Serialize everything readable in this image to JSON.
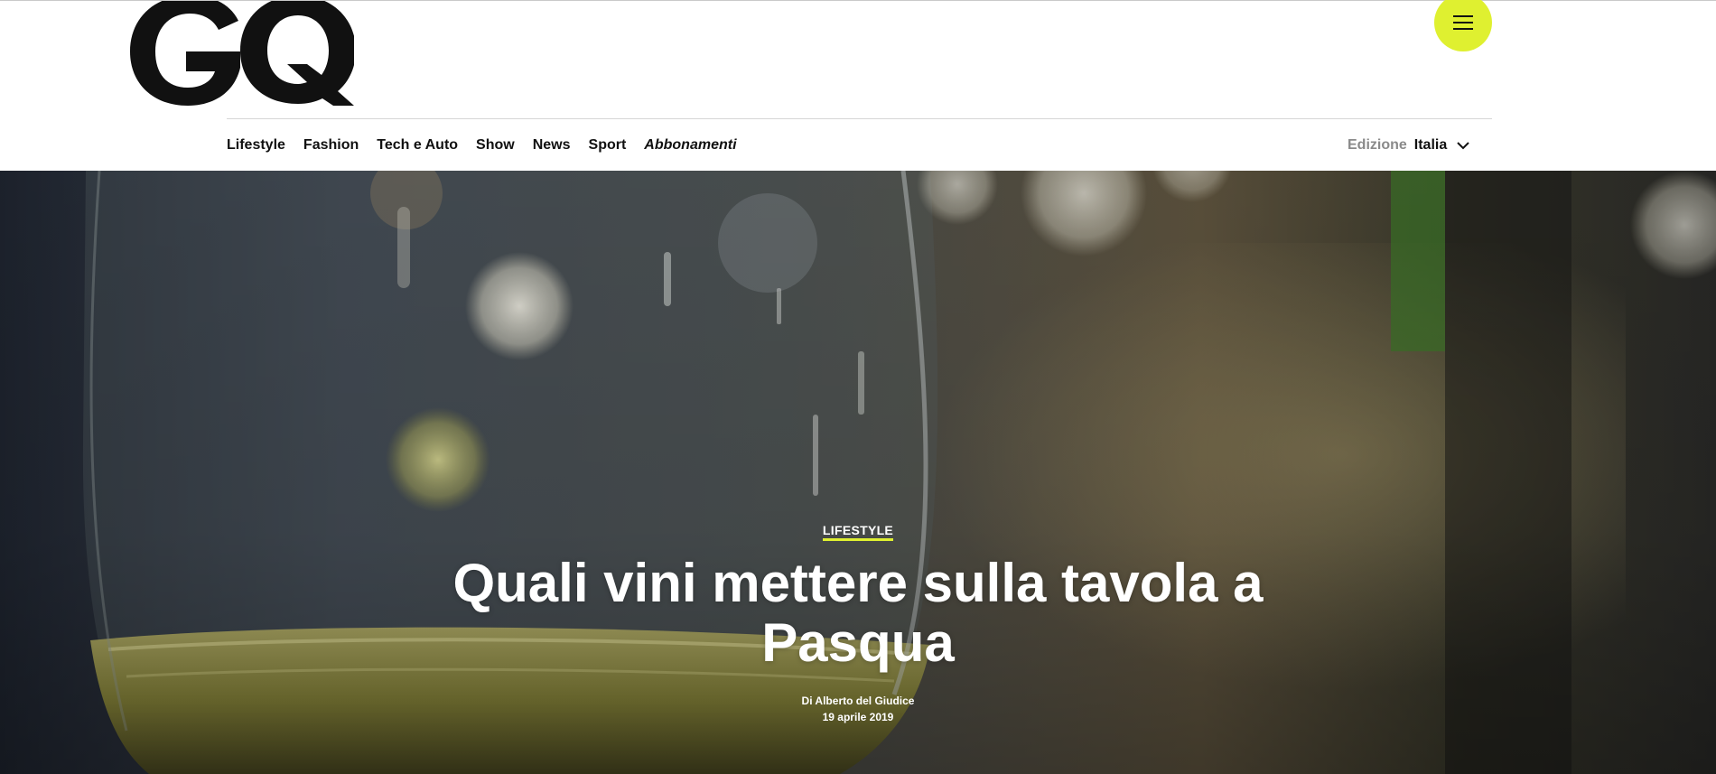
{
  "brand": {
    "logo_text": "GQ",
    "accent_color": "#dff030"
  },
  "header": {
    "menu_icon": "hamburger-menu-icon",
    "nav": [
      {
        "label": "Lifestyle",
        "italic": false
      },
      {
        "label": "Fashion",
        "italic": false
      },
      {
        "label": "Tech e Auto",
        "italic": false
      },
      {
        "label": "Show",
        "italic": false
      },
      {
        "label": "News",
        "italic": false
      },
      {
        "label": "Sport",
        "italic": false
      },
      {
        "label": "Abbonamenti",
        "italic": true
      }
    ],
    "edition": {
      "label": "Edizione",
      "value": "Italia",
      "icon": "chevron-down-icon"
    }
  },
  "article": {
    "category": "LIFESTYLE",
    "title": "Quali vini mettere sulla tavola a Pasqua",
    "byline": "Di Alberto del Giudice",
    "date": "19 aprile 2019",
    "hero_image": "wine-glass-photo"
  }
}
